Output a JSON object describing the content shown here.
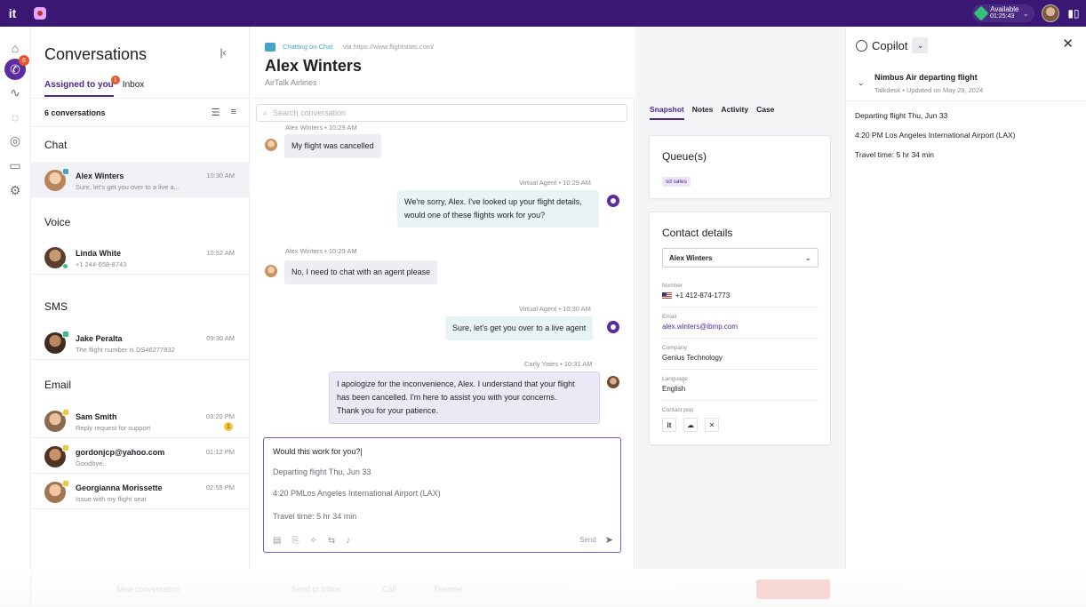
{
  "topbar": {
    "logo": "it",
    "status_label": "Available",
    "status_timer": "01:25:43",
    "status_color": "#34c17b",
    "bar_color": "#3b1774"
  },
  "rail": {
    "badge": "6",
    "icons": [
      "home-icon",
      "conversations-icon",
      "activity-icon",
      "chat-icon",
      "contacts-icon",
      "database-icon",
      "settings-icon"
    ]
  },
  "conversations": {
    "title": "Conversations",
    "tabs": [
      {
        "label": "Assigned to you",
        "badge": "1"
      },
      {
        "label": "Inbox"
      }
    ],
    "count": "6 conversations",
    "groups": {
      "chat": "Chat",
      "voice": "Voice",
      "sms": "SMS",
      "email": "Email"
    },
    "items": [
      {
        "name": "Alex Winters",
        "preview": "Sure, let's get you over to a live a...",
        "time": "10:30 AM"
      },
      {
        "name": "Linda White",
        "preview": "+1 244-658-8743",
        "time": "10:52 AM"
      },
      {
        "name": "Jake Peralta",
        "preview": "The flight number is DS46277832",
        "time": "09:30 AM"
      },
      {
        "name": "Sam Smith",
        "preview": "Reply request for support",
        "time": "03:20 PM",
        "notif": "1"
      },
      {
        "name": "gordonjcp@yahoo.com",
        "preview": "Goodbye.",
        "time": "01:12 PM"
      },
      {
        "name": "Georgianna Morissette",
        "preview": "Issue with my flight seat",
        "time": "02:55 PM"
      }
    ]
  },
  "chat": {
    "channel_label": "Chatting on Chat",
    "via": "via https://www.flightstats.com/",
    "contact_name": "Alex Winters",
    "company": "AirTalk Airlines",
    "search_placeholder": "Search conversation",
    "messages": [
      {
        "meta": "Alex Winters • 10:29 AM",
        "text": "My flight was cancelled"
      },
      {
        "meta": "Virtual Agent • 10:29 AM",
        "lines": [
          "We're sorry, Alex. I've looked up your flight details,",
          "would one of these flights work for you?"
        ]
      },
      {
        "meta": "Alex Winters • 10:29 AM",
        "text": "No, I need to chat with an agent please"
      },
      {
        "meta": "Virtual Agent • 10:30 AM",
        "text": "Sure, let's get you over to a live agent"
      },
      {
        "meta": "Carly Yates • 10:31 AM",
        "lines": [
          "I apologize for the inconvenience, Alex. I understand that your flight",
          "has been cancelled. I'm here to assist you with your concerns.",
          "Thank you for your patience."
        ]
      }
    ],
    "composer": {
      "line1": "Would this work for you?|",
      "line2": "Departing flight Thu, Jun 33",
      "line3": "4:20 PMLos Angeles International Airport (LAX)",
      "line4": "Travel time: 5 hr 34 min",
      "send": "Send"
    }
  },
  "snapshot": {
    "tabs": [
      "Snapshot",
      "Notes",
      "Activity",
      "Case"
    ],
    "queue_title": "Queue(s)",
    "queue_chip": "sd sales",
    "contact_title": "Contact details",
    "contact_select": "Alex Winters",
    "fields": [
      {
        "label": "Number",
        "value": "+1 412-874-1773"
      },
      {
        "label": "Email",
        "value": "alex.winters@ibmp.com"
      },
      {
        "label": "Company",
        "value": "Genius Technology"
      },
      {
        "label": "Language",
        "value": "English"
      }
    ],
    "contact_pop_label": "Contact pop"
  },
  "copilot": {
    "title": "Copilot",
    "card_title": "Nimbus Air departing flight",
    "card_sub": "Talkdesk • Updated on May 29, 2024",
    "lines": [
      "Departing flight Thu, Jun 33",
      "4:20 PM Los Angeles International Airport (LAX)",
      "Travel time: 5 hr 34 min"
    ]
  },
  "footer": {
    "new_conversation": "New conversation",
    "send_to_inbox": "Send to Inbox",
    "call": "Call",
    "transfer": "Transfer",
    "end": "End Chat"
  }
}
